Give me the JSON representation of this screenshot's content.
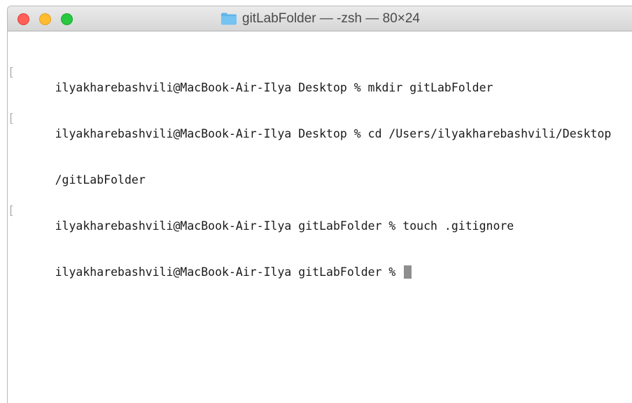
{
  "window": {
    "title": "gitLabFolder — -zsh — 80×24"
  },
  "terminal": {
    "lines": [
      "ilyakharebashvili@MacBook-Air-Ilya Desktop % mkdir gitLabFolder",
      "ilyakharebashvili@MacBook-Air-Ilya Desktop % cd /Users/ilyakharebashvili/Desktop",
      "/gitLabFolder",
      "ilyakharebashvili@MacBook-Air-Ilya gitLabFolder % touch .gitignore",
      "ilyakharebashvili@MacBook-Air-Ilya gitLabFolder % "
    ],
    "mark_left": "[",
    "mark_right": "]"
  },
  "colors": {
    "close": "#fe5f57",
    "minimize": "#febc2e",
    "zoom": "#28c840",
    "folder": "#5fb5ea"
  },
  "icons": {
    "title": "folder-icon"
  }
}
